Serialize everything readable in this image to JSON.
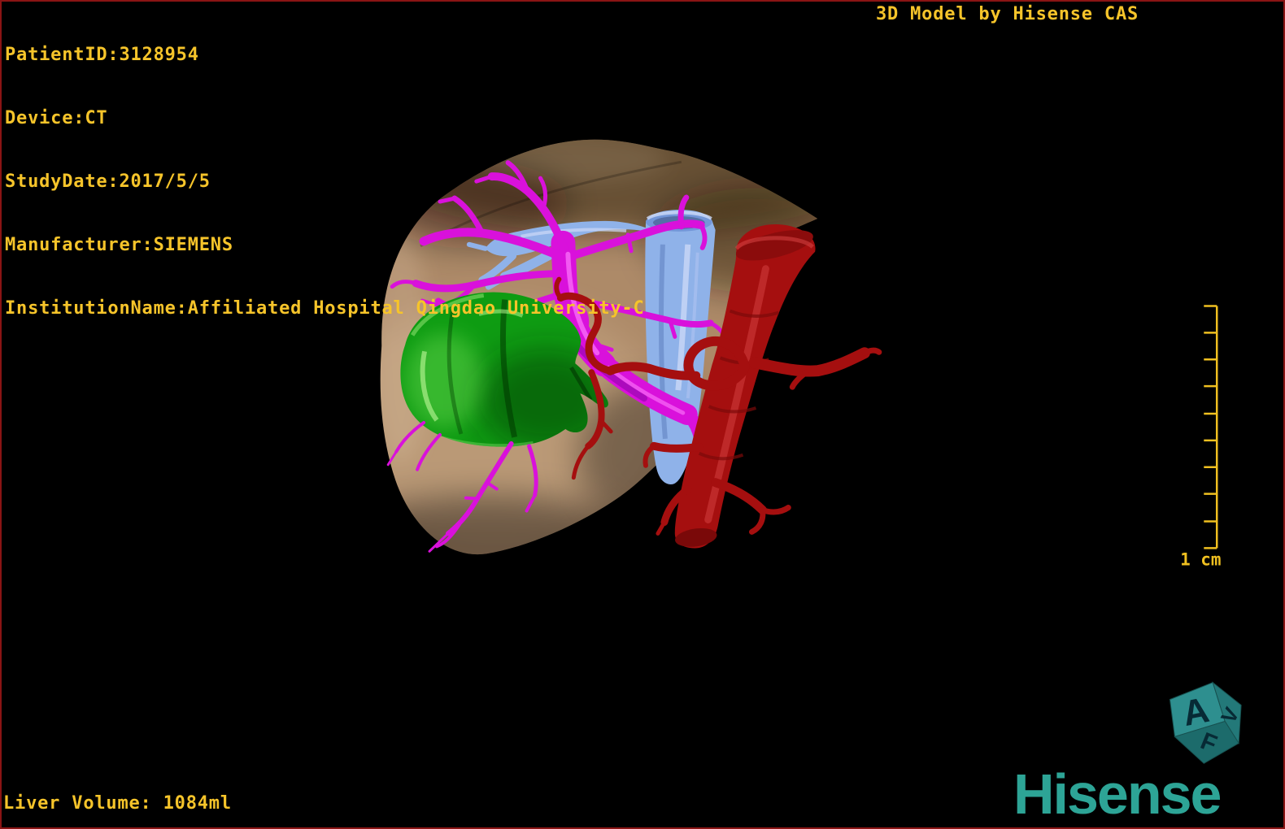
{
  "header": {
    "patient_info_lines": [
      "PatientID:3128954",
      "Device:CT",
      "StudyDate:2017/5/5",
      "Manufacturer:SIEMENS",
      "InstitutionName:Affiliated Hospital Qingdao University-C"
    ],
    "watermark": "3D Model by Hisense CAS"
  },
  "footer": {
    "liver_volume": "Liver Volume: 1084ml",
    "logo_text": "Hisense"
  },
  "scale_bar": {
    "label": "1 cm",
    "tick_count": 10
  },
  "orientation_cube": {
    "letters": {
      "top": "A",
      "bottom": "F",
      "right": "V"
    }
  },
  "colors": {
    "background": "#000000",
    "frame_border": "#8a1414",
    "overlay_text": "#f6c42a",
    "scale_bar": "#f0c020",
    "liver_tan": "#ad8a68",
    "tumor_green": "#0e9c12",
    "portal_vein_magenta": "#d911db",
    "hepatic_vein_blue": "#8fb2e9",
    "artery_red": "#a50f0f",
    "cube_teal": "#2e8f8f",
    "logo_teal": "#2da496"
  }
}
